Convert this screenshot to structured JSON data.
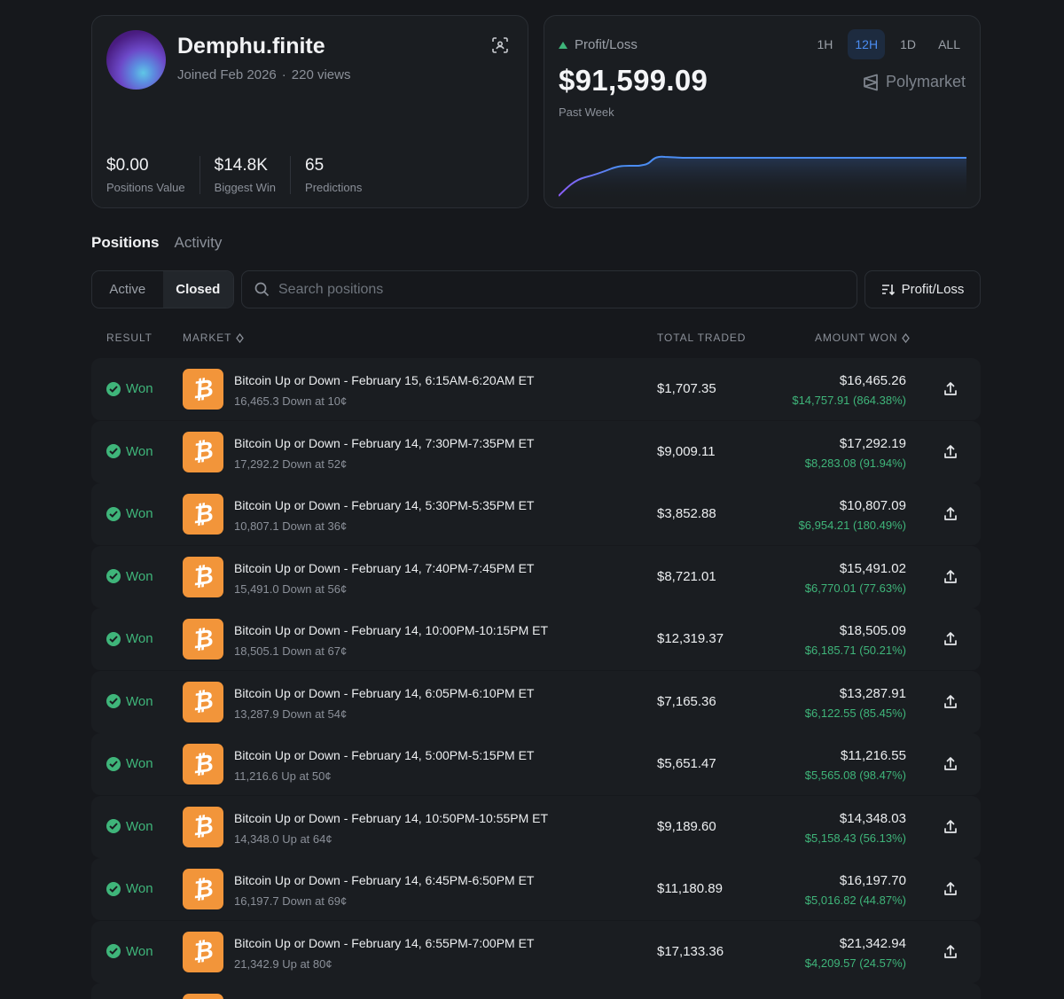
{
  "profile": {
    "username": "Demphu.finite",
    "joined": "Joined Feb 2026",
    "separator": "·",
    "views": "220 views",
    "stats": [
      {
        "value": "$0.00",
        "label": "Positions Value"
      },
      {
        "value": "$14.8K",
        "label": "Biggest Win"
      },
      {
        "value": "65",
        "label": "Predictions"
      }
    ]
  },
  "pnl": {
    "label": "Profit/Loss",
    "value": "$91,599.09",
    "sub": "Past Week",
    "periods": [
      "1H",
      "12H",
      "1D",
      "ALL"
    ],
    "active_period": "12H",
    "brand": "Polymarket",
    "trend_color": "#3fb57a",
    "line_color": "#4b8df2"
  },
  "tabs": {
    "positions": "Positions",
    "activity": "Activity",
    "active": "Positions"
  },
  "filter": {
    "active": "Active",
    "closed": "Closed",
    "selected": "Closed"
  },
  "search": {
    "placeholder": "Search positions"
  },
  "sort": {
    "label": "Profit/Loss"
  },
  "table": {
    "headers": {
      "result": "RESULT",
      "market": "MARKET",
      "total_traded": "TOTAL TRADED",
      "amount_won": "AMOUNT WON"
    },
    "rows": [
      {
        "result": "Won",
        "title": "Bitcoin Up or Down - February 15, 6:15AM-6:20AM ET",
        "sub": "16,465.3 Down at 10¢",
        "traded": "$1,707.35",
        "won": "$16,465.26",
        "gain": "$14,757.91 (864.38%)"
      },
      {
        "result": "Won",
        "title": "Bitcoin Up or Down - February 14, 7:30PM-7:35PM ET",
        "sub": "17,292.2 Down at 52¢",
        "traded": "$9,009.11",
        "won": "$17,292.19",
        "gain": "$8,283.08 (91.94%)"
      },
      {
        "result": "Won",
        "title": "Bitcoin Up or Down - February 14, 5:30PM-5:35PM ET",
        "sub": "10,807.1 Down at 36¢",
        "traded": "$3,852.88",
        "won": "$10,807.09",
        "gain": "$6,954.21 (180.49%)"
      },
      {
        "result": "Won",
        "title": "Bitcoin Up or Down - February 14, 7:40PM-7:45PM ET",
        "sub": "15,491.0 Down at 56¢",
        "traded": "$8,721.01",
        "won": "$15,491.02",
        "gain": "$6,770.01 (77.63%)"
      },
      {
        "result": "Won",
        "title": "Bitcoin Up or Down - February 14, 10:00PM-10:15PM ET",
        "sub": "18,505.1 Down at 67¢",
        "traded": "$12,319.37",
        "won": "$18,505.09",
        "gain": "$6,185.71 (50.21%)"
      },
      {
        "result": "Won",
        "title": "Bitcoin Up or Down - February 14, 6:05PM-6:10PM ET",
        "sub": "13,287.9 Down at 54¢",
        "traded": "$7,165.36",
        "won": "$13,287.91",
        "gain": "$6,122.55 (85.45%)"
      },
      {
        "result": "Won",
        "title": "Bitcoin Up or Down - February 14, 5:00PM-5:15PM ET",
        "sub": "11,216.6 Up at 50¢",
        "traded": "$5,651.47",
        "won": "$11,216.55",
        "gain": "$5,565.08 (98.47%)"
      },
      {
        "result": "Won",
        "title": "Bitcoin Up or Down - February 14, 10:50PM-10:55PM ET",
        "sub": "14,348.0 Up at 64¢",
        "traded": "$9,189.60",
        "won": "$14,348.03",
        "gain": "$5,158.43 (56.13%)"
      },
      {
        "result": "Won",
        "title": "Bitcoin Up or Down - February 14, 6:45PM-6:50PM ET",
        "sub": "16,197.7 Down at 69¢",
        "traded": "$11,180.89",
        "won": "$16,197.70",
        "gain": "$5,016.82 (44.87%)"
      },
      {
        "result": "Won",
        "title": "Bitcoin Up or Down - February 14, 6:55PM-7:00PM ET",
        "sub": "21,342.9 Up at 80¢",
        "traded": "$17,133.36",
        "won": "$21,342.94",
        "gain": "$4,209.57 (24.57%)"
      }
    ]
  },
  "icons": {
    "market": "bitcoin-icon",
    "result": "check-circle-icon",
    "row_action": "share-icon"
  }
}
